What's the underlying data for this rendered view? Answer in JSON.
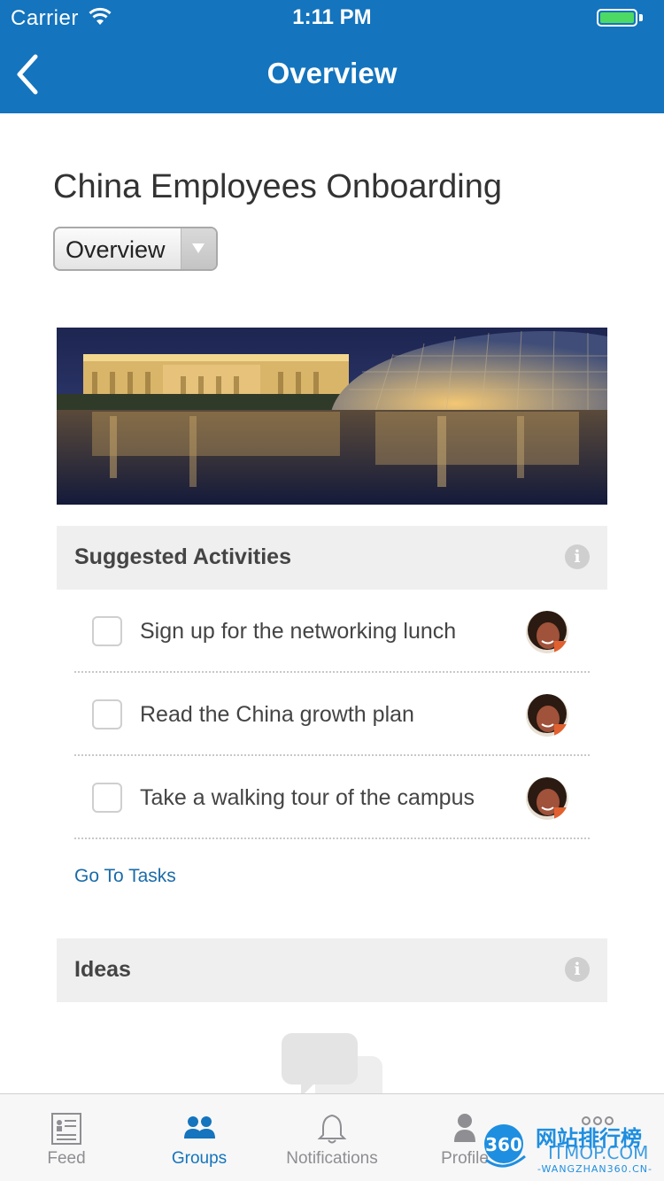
{
  "status_bar": {
    "carrier": "Carrier",
    "time": "1:11 PM"
  },
  "nav": {
    "title": "Overview",
    "back_icon": "chevron-left-icon"
  },
  "group": {
    "title": "China Employees Onboarding",
    "page_select": {
      "selected": "Overview"
    }
  },
  "suggested_activities": {
    "header": "Suggested Activities",
    "items": [
      {
        "label": "Sign up for the networking lunch",
        "checked": false
      },
      {
        "label": "Read the China growth plan",
        "checked": false
      },
      {
        "label": "Take a walking tour of the campus",
        "checked": false
      }
    ],
    "link": "Go To Tasks"
  },
  "ideas": {
    "header": "Ideas"
  },
  "tabs": [
    {
      "label": "Feed",
      "icon": "feed-icon",
      "active": false
    },
    {
      "label": "Groups",
      "icon": "groups-icon",
      "active": true
    },
    {
      "label": "Notifications",
      "icon": "bell-icon",
      "active": false
    },
    {
      "label": "Profile",
      "icon": "profile-icon",
      "active": false
    },
    {
      "label": "",
      "icon": "more-icon",
      "active": false
    }
  ],
  "watermark": {
    "badge": "360",
    "title": "网站排行榜",
    "subtitle": "-WANGZHAN360.CN-",
    "overlay": "ITMOP.COM"
  },
  "colors": {
    "brand": "#1474bd",
    "link": "#1a6ba8",
    "section_bg": "#efefef"
  }
}
